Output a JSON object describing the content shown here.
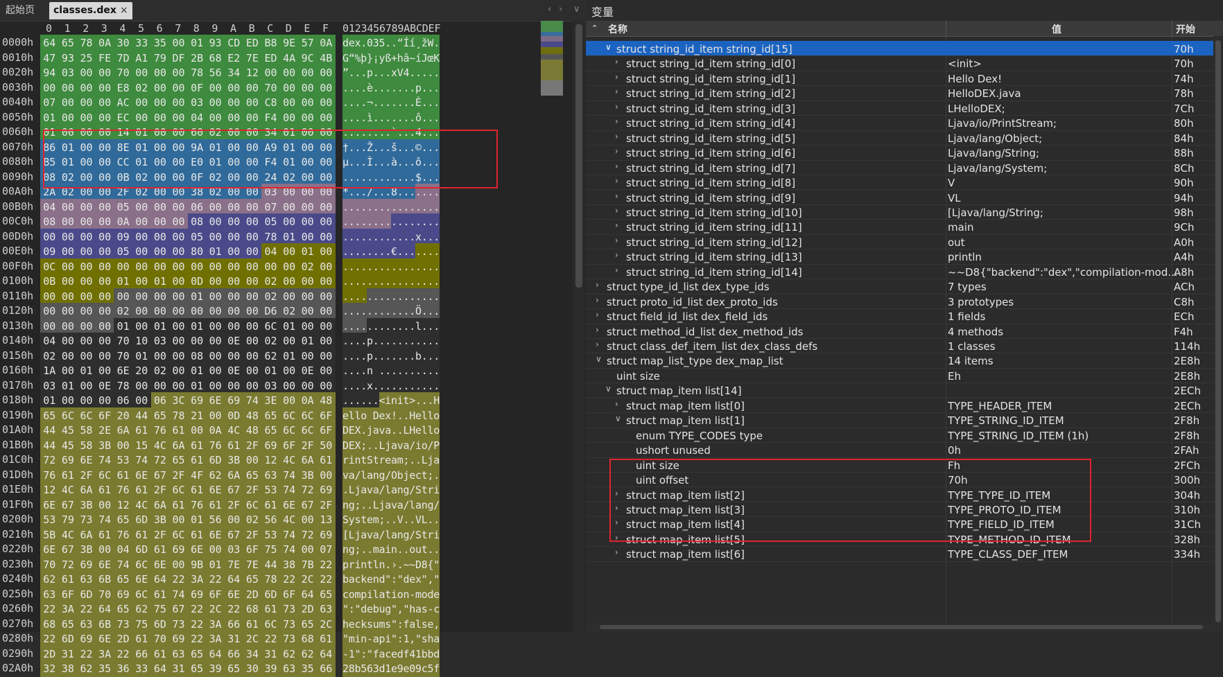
{
  "tabs": {
    "start": "起始页",
    "file": "classes.dex",
    "close": "×"
  },
  "nav": {
    "prev": "‹",
    "next": "›",
    "menu": "∨"
  },
  "hex": {
    "column_headers": [
      "0",
      "1",
      "2",
      "3",
      "4",
      "5",
      "6",
      "7",
      "8",
      "9",
      "A",
      "B",
      "C",
      "D",
      "E",
      "F"
    ],
    "ascii_header": "0123456789ABCDEF",
    "colors": {
      "header": "#3e8a3e",
      "string_ids": "#306a9a",
      "type_ids": "#8a7088",
      "proto_ids": "#4a4a8a",
      "field_ids": "#707000",
      "method_ids": "#565656",
      "code": "#2e2e2e",
      "data": "#7a7a30"
    },
    "rows": [
      {
        "off": "0000h",
        "bytes": "64 65 78 0A 30 33 35 00 01 93 CD ED B8 9E 57 0A",
        "ascii": "dex.035..“Íí¸žW.",
        "c": [
          "header"
        ]
      },
      {
        "off": "0010h",
        "bytes": "47 93 25 FE 7D A1 79 DF 2B 68 E2 7E ED 4A 9C 4B",
        "ascii": "G“%þ}¡yß+hâ~íJœK",
        "c": [
          "header"
        ]
      },
      {
        "off": "0020h",
        "bytes": "94 03 00 00 70 00 00 00 78 56 34 12 00 00 00 00",
        "ascii": "”...p...xV4.....",
        "c": [
          "header"
        ]
      },
      {
        "off": "0030h",
        "bytes": "00 00 00 00 E8 02 00 00 0F 00 00 00 70 00 00 00",
        "ascii": "....è.......p...",
        "c": [
          "header"
        ]
      },
      {
        "off": "0040h",
        "bytes": "07 00 00 00 AC 00 00 00 03 00 00 00 C8 00 00 00",
        "ascii": "....¬.......È...",
        "c": [
          "header"
        ]
      },
      {
        "off": "0050h",
        "bytes": "01 00 00 00 EC 00 00 00 04 00 00 00 F4 00 00 00",
        "ascii": "....ì.......ô...",
        "c": [
          "header"
        ]
      },
      {
        "off": "0060h",
        "bytes": "01 00 00 00 14 01 00 00 60 02 00 00 34 01 00 00",
        "ascii": "........`...4...",
        "c": [
          "header"
        ]
      },
      {
        "off": "0070h",
        "bytes": "86 01 00 00 8E 01 00 00 9A 01 00 00 A9 01 00 00",
        "ascii": "†...Ž...š...©...",
        "c": [
          "string_ids"
        ]
      },
      {
        "off": "0080h",
        "bytes": "B5 01 00 00 CC 01 00 00 E0 01 00 00 F4 01 00 00",
        "ascii": "µ...Ì...à...ô...",
        "c": [
          "string_ids"
        ]
      },
      {
        "off": "0090h",
        "bytes": "08 02 00 00 0B 02 00 00 0F 02 00 00 24 02 00 00",
        "ascii": "............$...",
        "c": [
          "string_ids"
        ]
      },
      {
        "off": "00A0h",
        "bytes": "2A 02 00 00 2F 02 00 00 38 02 00 00 03 00 00 00",
        "ascii": "*.../...8.......",
        "c": [
          "string_ids",
          12,
          "type_ids"
        ]
      },
      {
        "off": "00B0h",
        "bytes": "04 00 00 00 05 00 00 00 06 00 00 00 07 00 00 00",
        "ascii": "................",
        "c": [
          "type_ids"
        ]
      },
      {
        "off": "00C0h",
        "bytes": "08 00 00 00 0A 00 00 00 08 00 00 00 05 00 00 00",
        "ascii": "................",
        "c": [
          "type_ids",
          8,
          "proto_ids"
        ]
      },
      {
        "off": "00D0h",
        "bytes": "00 00 00 00 09 00 00 00 05 00 00 00 78 01 00 00",
        "ascii": "............x...",
        "c": [
          "proto_ids"
        ]
      },
      {
        "off": "00E0h",
        "bytes": "09 00 00 00 05 00 00 00 80 01 00 00 04 00 01 00",
        "ascii": "........€.......",
        "c": [
          "proto_ids",
          12,
          "field_ids"
        ]
      },
      {
        "off": "00F0h",
        "bytes": "0C 00 00 00 00 00 00 00 00 00 00 00 00 00 02 00",
        "ascii": "................",
        "c": [
          "field_ids"
        ]
      },
      {
        "off": "0100h",
        "bytes": "0B 00 00 00 01 00 01 00 0D 00 00 00 02 00 00 00",
        "ascii": "................",
        "c": [
          "field_ids"
        ]
      },
      {
        "off": "0110h",
        "bytes": "00 00 00 00 00 00 00 00 01 00 00 00 02 00 00 00",
        "ascii": "................",
        "c": [
          "field_ids",
          4,
          "method_ids"
        ]
      },
      {
        "off": "0120h",
        "bytes": "00 00 00 00 02 00 00 00 00 00 00 00 D6 02 00 00",
        "ascii": "............Ö...",
        "c": [
          "method_ids"
        ]
      },
      {
        "off": "0130h",
        "bytes": "00 00 00 00 01 00 01 00 01 00 00 00 6C 01 00 00",
        "ascii": "............l...",
        "c": [
          "method_ids",
          4,
          "code"
        ]
      },
      {
        "off": "0140h",
        "bytes": "04 00 00 00 70 10 03 00 00 00 0E 00 02 00 01 00",
        "ascii": "....p...........",
        "c": [
          "code"
        ]
      },
      {
        "off": "0150h",
        "bytes": "02 00 00 00 70 01 00 00 08 00 00 00 62 01 00 00",
        "ascii": "....p.......b...",
        "c": [
          "code"
        ]
      },
      {
        "off": "0160h",
        "bytes": "1A 00 01 00 6E 20 02 00 01 00 0E 00 01 00 0E 00",
        "ascii": "....n ..........",
        "c": [
          "code"
        ]
      },
      {
        "off": "0170h",
        "bytes": "03 01 00 0E 78 00 00 00 01 00 00 00 03 00 00 00",
        "ascii": "....x...........",
        "c": [
          "code"
        ]
      },
      {
        "off": "0180h",
        "bytes": "01 00 00 00 06 00 06 3C 69 6E 69 74 3E 00 0A 48",
        "ascii": "......<init>...H",
        "c": [
          "code",
          6,
          "data"
        ]
      },
      {
        "off": "0190h",
        "bytes": "65 6C 6C 6F 20 44 65 78 21 00 0D 48 65 6C 6C 6F",
        "ascii": "ello Dex!..Hello",
        "c": [
          "data"
        ]
      },
      {
        "off": "01A0h",
        "bytes": "44 45 58 2E 6A 61 76 61 00 0A 4C 48 65 6C 6C 6F",
        "ascii": "DEX.java..LHello",
        "c": [
          "data"
        ]
      },
      {
        "off": "01B0h",
        "bytes": "44 45 58 3B 00 15 4C 6A 61 76 61 2F 69 6F 2F 50",
        "ascii": "DEX;..Ljava/io/P",
        "c": [
          "data"
        ]
      },
      {
        "off": "01C0h",
        "bytes": "72 69 6E 74 53 74 72 65 61 6D 3B 00 12 4C 6A 61",
        "ascii": "rintStream;..Lja",
        "c": [
          "data"
        ]
      },
      {
        "off": "01D0h",
        "bytes": "76 61 2F 6C 61 6E 67 2F 4F 62 6A 65 63 74 3B 00",
        "ascii": "va/lang/Object;.",
        "c": [
          "data"
        ]
      },
      {
        "off": "01E0h",
        "bytes": "12 4C 6A 61 76 61 2F 6C 61 6E 67 2F 53 74 72 69",
        "ascii": ".Ljava/lang/Stri",
        "c": [
          "data"
        ]
      },
      {
        "off": "01F0h",
        "bytes": "6E 67 3B 00 12 4C 6A 61 76 61 2F 6C 61 6E 67 2F",
        "ascii": "ng;..Ljava/lang/",
        "c": [
          "data"
        ]
      },
      {
        "off": "0200h",
        "bytes": "53 79 73 74 65 6D 3B 00 01 56 00 02 56 4C 00 13",
        "ascii": "System;..V..VL..",
        "c": [
          "data"
        ]
      },
      {
        "off": "0210h",
        "bytes": "5B 4C 6A 61 76 61 2F 6C 61 6E 67 2F 53 74 72 69",
        "ascii": "[Ljava/lang/Stri",
        "c": [
          "data"
        ]
      },
      {
        "off": "0220h",
        "bytes": "6E 67 3B 00 04 6D 61 69 6E 00 03 6F 75 74 00 07",
        "ascii": "ng;..main..out..",
        "c": [
          "data"
        ]
      },
      {
        "off": "0230h",
        "bytes": "70 72 69 6E 74 6C 6E 00 9B 01 7E 7E 44 38 7B 22",
        "ascii": "println.›.~~D8{\"",
        "c": [
          "data"
        ]
      },
      {
        "off": "0240h",
        "bytes": "62 61 63 6B 65 6E 64 22 3A 22 64 65 78 22 2C 22",
        "ascii": "backend\":\"dex\",\"",
        "c": [
          "data"
        ]
      },
      {
        "off": "0250h",
        "bytes": "63 6F 6D 70 69 6C 61 74 69 6F 6E 2D 6D 6F 64 65",
        "ascii": "compilation-mode",
        "c": [
          "data"
        ]
      },
      {
        "off": "0260h",
        "bytes": "22 3A 22 64 65 62 75 67 22 2C 22 68 61 73 2D 63",
        "ascii": "\":\"debug\",\"has-c",
        "c": [
          "data"
        ]
      },
      {
        "off": "0270h",
        "bytes": "68 65 63 6B 73 75 6D 73 22 3A 66 61 6C 73 65 2C",
        "ascii": "hecksums\":false,",
        "c": [
          "data"
        ]
      },
      {
        "off": "0280h",
        "bytes": "22 6D 69 6E 2D 61 70 69 22 3A 31 2C 22 73 68 61",
        "ascii": "\"min-api\":1,\"sha",
        "c": [
          "data"
        ]
      },
      {
        "off": "0290h",
        "bytes": "2D 31 22 3A 22 66 61 63 65 64 66 34 31 62 62 64",
        "ascii": "-1\":\"facedf41bbd",
        "c": [
          "data"
        ]
      },
      {
        "off": "02A0h",
        "bytes": "32 38 62 35 36 33 64 31 65 39 65 30 39 63 35 66",
        "ascii": "28b563d1e9e09c5f",
        "c": [
          "data"
        ]
      }
    ]
  },
  "vars": {
    "title": "变量",
    "columns": {
      "name": "名称",
      "value": "值",
      "start": "开始"
    },
    "rows": [
      {
        "d": 1,
        "tw": "expanded",
        "name": "struct string_id_item string_id[15]",
        "value": "",
        "start": "70h",
        "sel": true
      },
      {
        "d": 2,
        "tw": "collapsed",
        "name": "struct string_id_item string_id[0]",
        "value": "<init>",
        "start": "70h"
      },
      {
        "d": 2,
        "tw": "collapsed",
        "name": "struct string_id_item string_id[1]",
        "value": "Hello Dex!",
        "start": "74h"
      },
      {
        "d": 2,
        "tw": "collapsed",
        "name": "struct string_id_item string_id[2]",
        "value": "HelloDEX.java",
        "start": "78h"
      },
      {
        "d": 2,
        "tw": "collapsed",
        "name": "struct string_id_item string_id[3]",
        "value": "LHelloDEX;",
        "start": "7Ch"
      },
      {
        "d": 2,
        "tw": "collapsed",
        "name": "struct string_id_item string_id[4]",
        "value": "Ljava/io/PrintStream;",
        "start": "80h"
      },
      {
        "d": 2,
        "tw": "collapsed",
        "name": "struct string_id_item string_id[5]",
        "value": "Ljava/lang/Object;",
        "start": "84h"
      },
      {
        "d": 2,
        "tw": "collapsed",
        "name": "struct string_id_item string_id[6]",
        "value": "Ljava/lang/String;",
        "start": "88h"
      },
      {
        "d": 2,
        "tw": "collapsed",
        "name": "struct string_id_item string_id[7]",
        "value": "Ljava/lang/System;",
        "start": "8Ch"
      },
      {
        "d": 2,
        "tw": "collapsed",
        "name": "struct string_id_item string_id[8]",
        "value": "V",
        "start": "90h"
      },
      {
        "d": 2,
        "tw": "collapsed",
        "name": "struct string_id_item string_id[9]",
        "value": "VL",
        "start": "94h"
      },
      {
        "d": 2,
        "tw": "collapsed",
        "name": "struct string_id_item string_id[10]",
        "value": "[Ljava/lang/String;",
        "start": "98h"
      },
      {
        "d": 2,
        "tw": "collapsed",
        "name": "struct string_id_item string_id[11]",
        "value": "main",
        "start": "9Ch"
      },
      {
        "d": 2,
        "tw": "collapsed",
        "name": "struct string_id_item string_id[12]",
        "value": "out",
        "start": "A0h"
      },
      {
        "d": 2,
        "tw": "collapsed",
        "name": "struct string_id_item string_id[13]",
        "value": "println",
        "start": "A4h"
      },
      {
        "d": 2,
        "tw": "collapsed",
        "name": "struct string_id_item string_id[14]",
        "value": "~~D8{\"backend\":\"dex\",\"compilation-mod...",
        "start": "A8h"
      },
      {
        "d": 0,
        "tw": "collapsed",
        "name": "struct type_id_list dex_type_ids",
        "value": "7 types",
        "start": "ACh"
      },
      {
        "d": 0,
        "tw": "collapsed",
        "name": "struct proto_id_list dex_proto_ids",
        "value": "3 prototypes",
        "start": "C8h"
      },
      {
        "d": 0,
        "tw": "collapsed",
        "name": "struct field_id_list dex_field_ids",
        "value": "1 fields",
        "start": "ECh"
      },
      {
        "d": 0,
        "tw": "collapsed",
        "name": "struct method_id_list dex_method_ids",
        "value": "4 methods",
        "start": "F4h"
      },
      {
        "d": 0,
        "tw": "collapsed",
        "name": "struct class_def_item_list dex_class_defs",
        "value": "1 classes",
        "start": "114h"
      },
      {
        "d": 0,
        "tw": "expanded",
        "name": "struct map_list_type dex_map_list",
        "value": "14 items",
        "start": "2E8h"
      },
      {
        "d": 1,
        "tw": "",
        "name": "uint size",
        "value": "Eh",
        "start": "2E8h"
      },
      {
        "d": 1,
        "tw": "expanded",
        "name": "struct map_item list[14]",
        "value": "",
        "start": "2ECh"
      },
      {
        "d": 2,
        "tw": "collapsed",
        "name": "struct map_item list[0]",
        "value": "TYPE_HEADER_ITEM",
        "start": "2ECh"
      },
      {
        "d": 2,
        "tw": "expanded",
        "name": "struct map_item list[1]",
        "value": "TYPE_STRING_ID_ITEM",
        "start": "2F8h"
      },
      {
        "d": 3,
        "tw": "",
        "name": "enum TYPE_CODES type",
        "value": "TYPE_STRING_ID_ITEM (1h)",
        "start": "2F8h"
      },
      {
        "d": 3,
        "tw": "",
        "name": "ushort unused",
        "value": "0h",
        "start": "2FAh"
      },
      {
        "d": 3,
        "tw": "",
        "name": "uint size",
        "value": "Fh",
        "start": "2FCh"
      },
      {
        "d": 3,
        "tw": "",
        "name": "uint offset",
        "value": "70h",
        "start": "300h"
      },
      {
        "d": 2,
        "tw": "collapsed",
        "name": "struct map_item list[2]",
        "value": "TYPE_TYPE_ID_ITEM",
        "start": "304h"
      },
      {
        "d": 2,
        "tw": "collapsed",
        "name": "struct map_item list[3]",
        "value": "TYPE_PROTO_ID_ITEM",
        "start": "310h"
      },
      {
        "d": 2,
        "tw": "collapsed",
        "name": "struct map_item list[4]",
        "value": "TYPE_FIELD_ID_ITEM",
        "start": "31Ch"
      },
      {
        "d": 2,
        "tw": "collapsed",
        "name": "struct map_item list[5]",
        "value": "TYPE_METHOD_ID_ITEM",
        "start": "328h"
      },
      {
        "d": 2,
        "tw": "collapsed",
        "name": "struct map_item list[6]",
        "value": "TYPE_CLASS_DEF_ITEM",
        "start": "334h"
      }
    ]
  }
}
